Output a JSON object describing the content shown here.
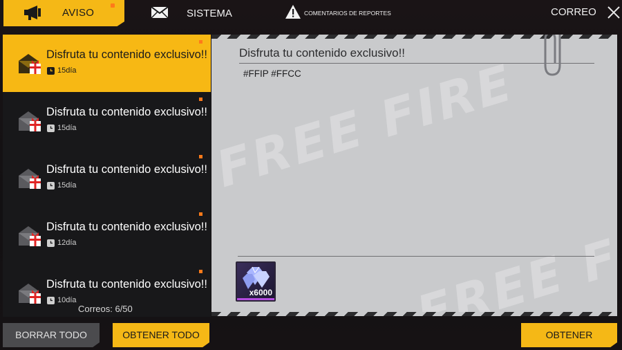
{
  "tabs": {
    "aviso": "AVISO",
    "sistema": "SISTEMA",
    "reportes": "COMENTARIOS DE REPORTES"
  },
  "window_title": "CORREO",
  "mails": [
    {
      "title": "Disfruta tu contenido exclusivo!!",
      "days": "15día",
      "active": true
    },
    {
      "title": "Disfruta tu contenido exclusivo!!",
      "days": "15día",
      "active": false
    },
    {
      "title": "Disfruta tu contenido exclusivo!!",
      "days": "15día",
      "active": false
    },
    {
      "title": "Disfruta tu contenido exclusivo!!",
      "days": "12día",
      "active": false
    },
    {
      "title": "Disfruta tu contenido exclusivo!!",
      "days": "10día",
      "active": false
    }
  ],
  "mail_count": "Correos: 6/50",
  "detail": {
    "title": "Disfruta tu contenido exclusivo!!",
    "body": "#FFIP #FFCC",
    "reward_qty": "x6000"
  },
  "buttons": {
    "borrar_todo": "BORRAR TODO",
    "obtener_todo": "OBTENER TODO",
    "obtener": "OBTENER"
  },
  "colors": {
    "accent": "#f5b816",
    "notification": "#ff7a1a",
    "panel": "#c9cacc"
  }
}
